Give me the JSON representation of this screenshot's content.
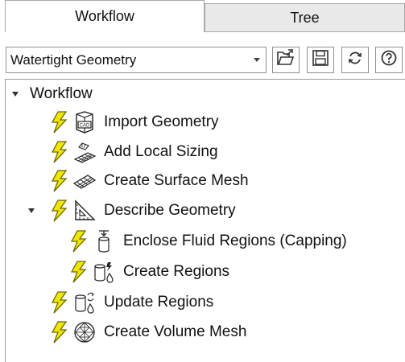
{
  "tabs": [
    {
      "label": "Workflow",
      "active": true
    },
    {
      "label": "Tree",
      "active": false
    }
  ],
  "toolbar": {
    "workflow_select": "Watertight Geometry",
    "icons": [
      "open-folder-icon",
      "save-icon",
      "refresh-icon",
      "help-icon"
    ]
  },
  "tree": {
    "root_label": "Workflow",
    "items": [
      {
        "label": "Import Geometry",
        "icon": "cad-import-icon"
      },
      {
        "label": "Add Local Sizing",
        "icon": "local-sizing-icon"
      },
      {
        "label": "Create Surface Mesh",
        "icon": "surface-mesh-icon"
      },
      {
        "label": "Describe Geometry",
        "icon": "describe-geometry-icon"
      },
      {
        "label": "Enclose Fluid Regions (Capping)",
        "icon": "capping-icon"
      },
      {
        "label": "Create Regions",
        "icon": "create-regions-icon"
      },
      {
        "label": "Update Regions",
        "icon": "update-regions-icon"
      },
      {
        "label": "Create Volume Mesh",
        "icon": "volume-mesh-icon"
      }
    ]
  },
  "colors": {
    "bolt_fill": "#f2e600",
    "bolt_stroke": "#6b6b00",
    "tab_inactive": "#e9e9e9",
    "border": "#a9a9a9"
  }
}
